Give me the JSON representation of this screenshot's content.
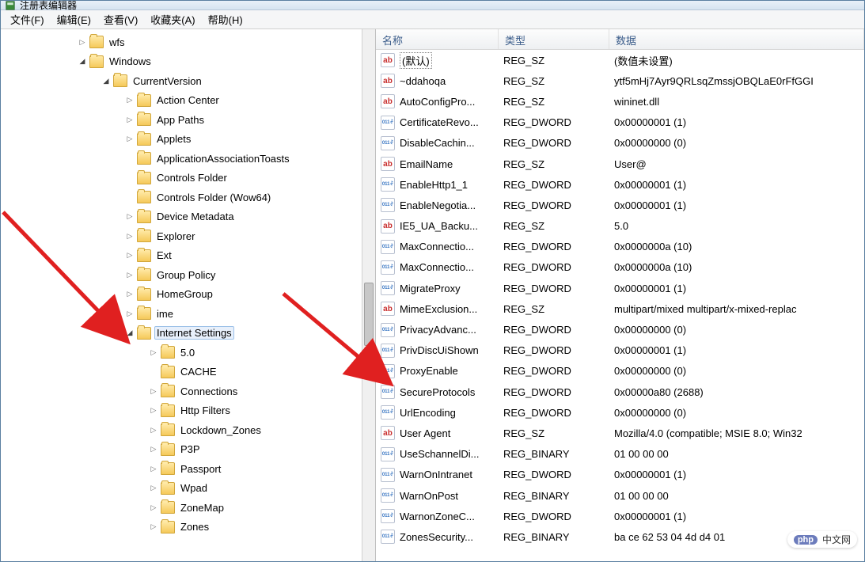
{
  "title": "注册表编辑器",
  "menubar": {
    "file": "文件(F)",
    "edit": "编辑(E)",
    "view": "查看(V)",
    "favorites": "收藏夹(A)",
    "help": "帮助(H)"
  },
  "tree": [
    {
      "indent": 3,
      "toggle": "closed",
      "label": "wfs",
      "selected": false
    },
    {
      "indent": 3,
      "toggle": "open",
      "label": "Windows",
      "selected": false
    },
    {
      "indent": 4,
      "toggle": "open",
      "label": "CurrentVersion",
      "selected": false
    },
    {
      "indent": 5,
      "toggle": "closed",
      "label": "Action Center",
      "selected": false
    },
    {
      "indent": 5,
      "toggle": "closed",
      "label": "App Paths",
      "selected": false
    },
    {
      "indent": 5,
      "toggle": "closed",
      "label": "Applets",
      "selected": false
    },
    {
      "indent": 5,
      "toggle": "none",
      "label": "ApplicationAssociationToasts",
      "selected": false
    },
    {
      "indent": 5,
      "toggle": "none",
      "label": "Controls Folder",
      "selected": false
    },
    {
      "indent": 5,
      "toggle": "none",
      "label": "Controls Folder (Wow64)",
      "selected": false
    },
    {
      "indent": 5,
      "toggle": "closed",
      "label": "Device Metadata",
      "selected": false
    },
    {
      "indent": 5,
      "toggle": "closed",
      "label": "Explorer",
      "selected": false
    },
    {
      "indent": 5,
      "toggle": "closed",
      "label": "Ext",
      "selected": false
    },
    {
      "indent": 5,
      "toggle": "closed",
      "label": "Group Policy",
      "selected": false
    },
    {
      "indent": 5,
      "toggle": "closed",
      "label": "HomeGroup",
      "selected": false
    },
    {
      "indent": 5,
      "toggle": "closed",
      "label": "ime",
      "selected": false
    },
    {
      "indent": 5,
      "toggle": "open",
      "label": "Internet Settings",
      "selected": true
    },
    {
      "indent": 6,
      "toggle": "closed",
      "label": "5.0",
      "selected": false
    },
    {
      "indent": 6,
      "toggle": "none",
      "label": "CACHE",
      "selected": false
    },
    {
      "indent": 6,
      "toggle": "closed",
      "label": "Connections",
      "selected": false
    },
    {
      "indent": 6,
      "toggle": "closed",
      "label": "Http Filters",
      "selected": false
    },
    {
      "indent": 6,
      "toggle": "closed",
      "label": "Lockdown_Zones",
      "selected": false
    },
    {
      "indent": 6,
      "toggle": "closed",
      "label": "P3P",
      "selected": false
    },
    {
      "indent": 6,
      "toggle": "closed",
      "label": "Passport",
      "selected": false
    },
    {
      "indent": 6,
      "toggle": "closed",
      "label": "Wpad",
      "selected": false
    },
    {
      "indent": 6,
      "toggle": "closed",
      "label": "ZoneMap",
      "selected": false
    },
    {
      "indent": 6,
      "toggle": "closed",
      "label": "Zones",
      "selected": false
    }
  ],
  "list": {
    "columns": {
      "name": "名称",
      "type": "类型",
      "data": "数据"
    },
    "rows": [
      {
        "icon": "sz",
        "name": "(默认)",
        "type": "REG_SZ",
        "data": "(数值未设置)",
        "default": true
      },
      {
        "icon": "sz",
        "name": "~ddahoqa",
        "type": "REG_SZ",
        "data": "ytf5mHj7Ayr9QRLsqZmssjOBQLaE0rFfGGI"
      },
      {
        "icon": "sz",
        "name": "AutoConfigPro...",
        "type": "REG_SZ",
        "data": "wininet.dll"
      },
      {
        "icon": "bin",
        "name": "CertificateRevo...",
        "type": "REG_DWORD",
        "data": "0x00000001 (1)"
      },
      {
        "icon": "bin",
        "name": "DisableCachin...",
        "type": "REG_DWORD",
        "data": "0x00000000 (0)"
      },
      {
        "icon": "sz",
        "name": "EmailName",
        "type": "REG_SZ",
        "data": "User@"
      },
      {
        "icon": "bin",
        "name": "EnableHttp1_1",
        "type": "REG_DWORD",
        "data": "0x00000001 (1)"
      },
      {
        "icon": "bin",
        "name": "EnableNegotia...",
        "type": "REG_DWORD",
        "data": "0x00000001 (1)"
      },
      {
        "icon": "sz",
        "name": "IE5_UA_Backu...",
        "type": "REG_SZ",
        "data": "5.0"
      },
      {
        "icon": "bin",
        "name": "MaxConnectio...",
        "type": "REG_DWORD",
        "data": "0x0000000a (10)"
      },
      {
        "icon": "bin",
        "name": "MaxConnectio...",
        "type": "REG_DWORD",
        "data": "0x0000000a (10)"
      },
      {
        "icon": "bin",
        "name": "MigrateProxy",
        "type": "REG_DWORD",
        "data": "0x00000001 (1)"
      },
      {
        "icon": "sz",
        "name": "MimeExclusion...",
        "type": "REG_SZ",
        "data": "multipart/mixed multipart/x-mixed-replac"
      },
      {
        "icon": "bin",
        "name": "PrivacyAdvanc...",
        "type": "REG_DWORD",
        "data": "0x00000000 (0)"
      },
      {
        "icon": "bin",
        "name": "PrivDiscUiShown",
        "type": "REG_DWORD",
        "data": "0x00000001 (1)"
      },
      {
        "icon": "bin",
        "name": "ProxyEnable",
        "type": "REG_DWORD",
        "data": "0x00000000 (0)"
      },
      {
        "icon": "bin",
        "name": "SecureProtocols",
        "type": "REG_DWORD",
        "data": "0x00000a80 (2688)"
      },
      {
        "icon": "bin",
        "name": "UrlEncoding",
        "type": "REG_DWORD",
        "data": "0x00000000 (0)"
      },
      {
        "icon": "sz",
        "name": "User Agent",
        "type": "REG_SZ",
        "data": "Mozilla/4.0 (compatible; MSIE 8.0; Win32"
      },
      {
        "icon": "bin",
        "name": "UseSchannelDi...",
        "type": "REG_BINARY",
        "data": "01 00 00 00"
      },
      {
        "icon": "bin",
        "name": "WarnOnIntranet",
        "type": "REG_DWORD",
        "data": "0x00000001 (1)"
      },
      {
        "icon": "bin",
        "name": "WarnOnPost",
        "type": "REG_BINARY",
        "data": "01 00 00 00"
      },
      {
        "icon": "bin",
        "name": "WarnonZoneC...",
        "type": "REG_DWORD",
        "data": "0x00000001 (1)"
      },
      {
        "icon": "bin",
        "name": "ZonesSecurity...",
        "type": "REG_BINARY",
        "data": "ba ce 62 53 04 4d d4 01"
      }
    ]
  },
  "watermark": {
    "badge": "php",
    "text": "中文网"
  }
}
